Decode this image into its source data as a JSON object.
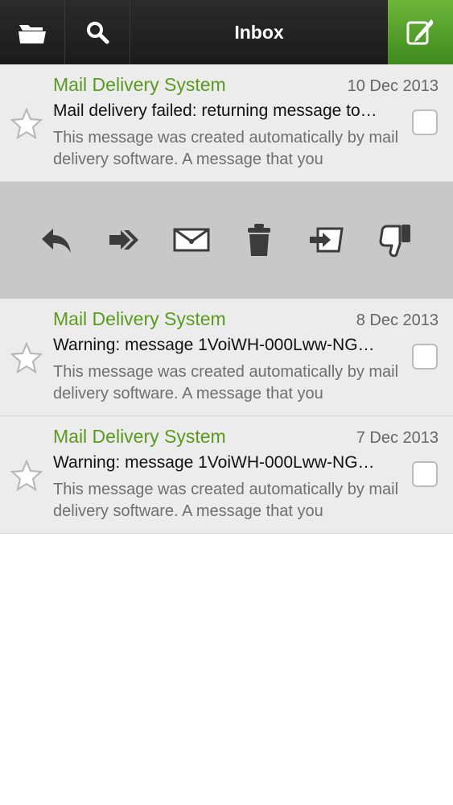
{
  "header": {
    "title": "Inbox",
    "icons": [
      "folder-icon",
      "search-icon",
      "compose-icon"
    ]
  },
  "messages": [
    {
      "sender": "Mail Delivery System",
      "date": "10 Dec 2013",
      "subject": "Mail delivery failed: returning message to…",
      "preview": "This message was created automatically by mail delivery software. A message that you"
    },
    {
      "sender": "Mail Delivery System",
      "date": "8 Dec 2013",
      "subject": "Warning: message 1VoiWH-000Lww-NG…",
      "preview": "This message was created automatically by mail delivery software. A message that you"
    },
    {
      "sender": "Mail Delivery System",
      "date": "7 Dec 2013",
      "subject": "Warning: message 1VoiWH-000Lww-NG…",
      "preview": "This message was created automatically by mail delivery software. A message that you"
    }
  ],
  "actions": [
    "reply-icon",
    "forward-icon",
    "mark-unread-icon",
    "trash-icon",
    "move-icon",
    "spam-icon"
  ],
  "colors": {
    "accent": "#5a9a1e",
    "compose": "#4f9e25",
    "topbar": "#222222"
  }
}
